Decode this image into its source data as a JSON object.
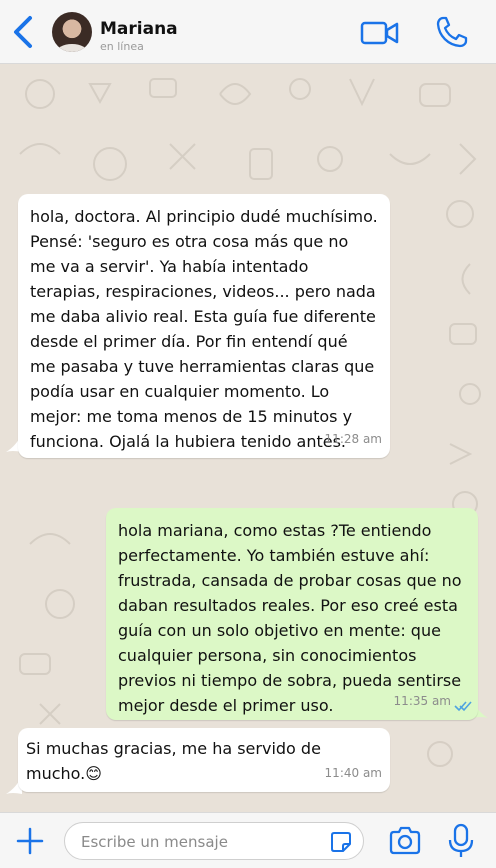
{
  "header": {
    "contact_name": "Mariana",
    "status": "en línea"
  },
  "messages": [
    {
      "direction": "incoming",
      "text": "hola, doctora. Al principio dudé muchísimo. Pensé: 'seguro es otra cosa más que no me va a servir'. Ya había intentado terapias, respiraciones, videos... pero nada me daba alivio real. Esta guía fue diferente desde el primer día. Por fin entendí qué me pasaba y tuve herramientas claras que podía usar en cualquier momento. Lo mejor: me toma menos de 15 minutos y funciona. Ojalá la hubiera tenido antes.",
      "time": "11:28 am"
    },
    {
      "direction": "outgoing",
      "text": "hola mariana, como estas ?Te entiendo perfectamente. Yo también estuve ahí: frustrada, cansada de probar cosas que no daban resultados reales. Por eso creé esta guía con un solo objetivo en mente: que cualquier persona, sin conocimientos previos ni tiempo de sobra, pueda sentirse mejor desde el primer uso.",
      "time": "11:35 am",
      "status": "read"
    },
    {
      "direction": "incoming",
      "text": "Si muchas gracias, me ha servido de mucho.😊",
      "time": "11:40 am"
    }
  ],
  "input": {
    "placeholder": "Escribe un mensaje"
  },
  "colors": {
    "accent": "#1a73e8",
    "incoming_bubble": "#ffffff",
    "outgoing_bubble": "#dcf8c6",
    "read_ticks": "#4fa3e0"
  },
  "icons": {
    "back": "chevron-left-icon",
    "video": "video-camera-icon",
    "call": "phone-icon",
    "attach": "plus-icon",
    "sticker": "sticker-icon",
    "camera": "camera-icon",
    "mic": "microphone-icon"
  }
}
